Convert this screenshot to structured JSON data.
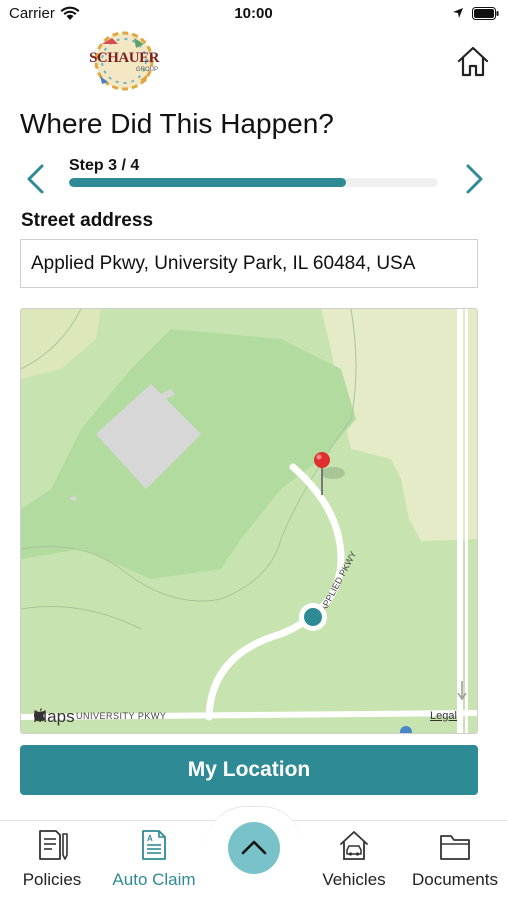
{
  "status_bar": {
    "carrier": "Carrier",
    "time": "10:00"
  },
  "header": {
    "logo_text": "SCHAUER",
    "logo_subtext": "GROUP"
  },
  "page": {
    "title": "Where Did This Happen?"
  },
  "stepper": {
    "label": "Step 3 / 4",
    "progress_percent": 75
  },
  "address": {
    "label": "Street address",
    "value": "Applied Pkwy, University Park, IL 60484, USA"
  },
  "map": {
    "brand": "Maps",
    "legal": "Legal",
    "road_label_university": "UNIVERSITY PKWY",
    "road_label_applied": "APPLIED PKWY"
  },
  "actions": {
    "my_location": "My Location"
  },
  "tabs": [
    {
      "label": "Policies",
      "icon": "policies-icon",
      "active": false
    },
    {
      "label": "Auto Claim",
      "icon": "auto-claim-icon",
      "active": true
    },
    {
      "label": "Vehicles",
      "icon": "vehicles-icon",
      "active": false
    },
    {
      "label": "Documents",
      "icon": "documents-icon",
      "active": false
    }
  ],
  "colors": {
    "accent": "#2e8b96",
    "fab": "#79c2c9",
    "map_grass": "#c7e4b0",
    "map_park": "#b2dba0",
    "pin": "#e02f2f"
  }
}
